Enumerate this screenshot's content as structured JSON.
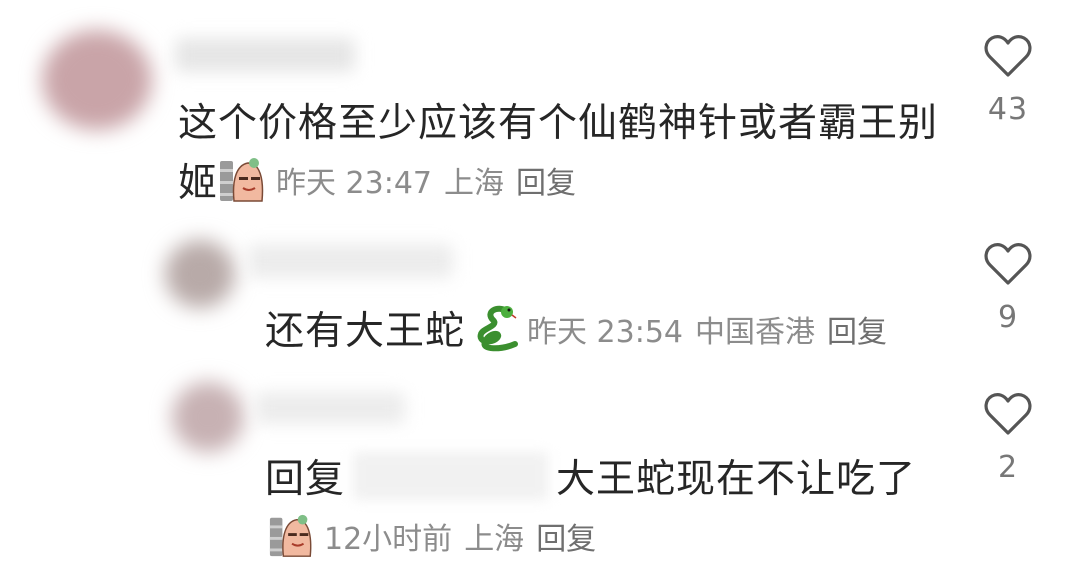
{
  "comments": [
    {
      "text_line1": "这个价格至少应该有个仙鹤神针或者霸王别",
      "text_line2": "姬",
      "time": "昨天 23:47",
      "location": "上海",
      "reply_label": "回复",
      "like_count": "43",
      "sticker": "sausage-face-sticker"
    },
    {
      "text": "还有大王蛇",
      "emoji": "🐍",
      "time": "昨天 23:54",
      "location": "中国香港",
      "reply_label": "回复",
      "like_count": "9"
    },
    {
      "reply_prefix": "回复",
      "text": "大王蛇现在不让吃了",
      "time": "12小时前",
      "location": "上海",
      "reply_label": "回复",
      "like_count": "2",
      "sticker": "sausage-face-sticker"
    }
  ],
  "colors": {
    "text": "#262626",
    "meta": "#8c8c8c",
    "icon": "#555555"
  }
}
